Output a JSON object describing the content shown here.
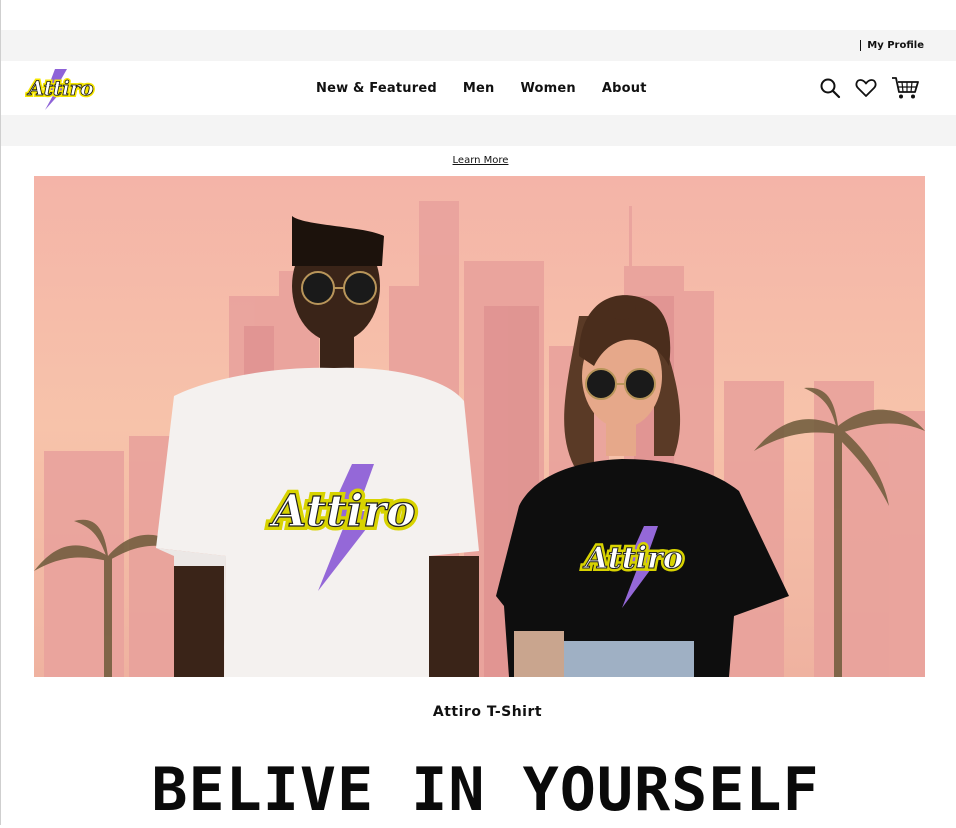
{
  "utility_bar": {
    "profile_label": "My Profile"
  },
  "brand": {
    "logo_text": "Attiro"
  },
  "nav": {
    "items": [
      {
        "label": "New & Featured"
      },
      {
        "label": "Men"
      },
      {
        "label": "Women"
      },
      {
        "label": "About"
      }
    ],
    "icons": [
      "search-icon",
      "heart-icon",
      "cart-icon"
    ]
  },
  "promo": {
    "link_label": "Learn More"
  },
  "hero": {
    "shirt_logo_text": "Attiro",
    "colors": {
      "sky": "#f6b9a6",
      "city": "#e58f8d",
      "palm": "#6d5a3a"
    }
  },
  "product": {
    "caption": "Attiro T-Shirt"
  },
  "headline": {
    "text": "BELIVE IN YOURSELF"
  }
}
